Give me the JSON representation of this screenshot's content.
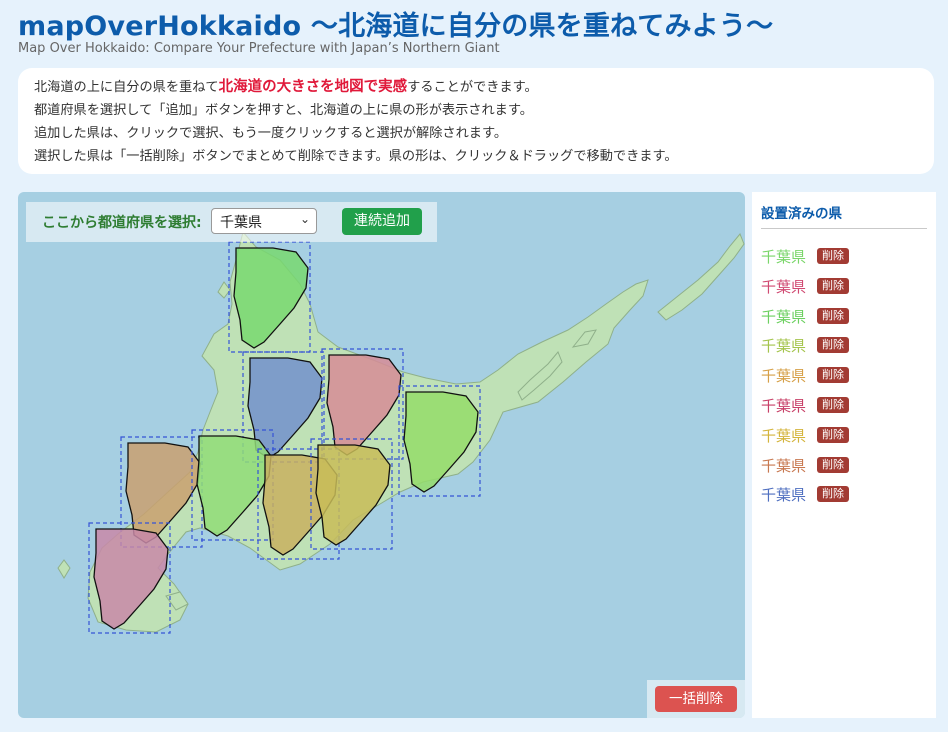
{
  "header": {
    "title": "mapOverHokkaido ～北海道に自分の県を重ねてみよう～",
    "subtitle": "Map Over Hokkaido: Compare Your Prefecture with Japan’s Northern Giant"
  },
  "description": {
    "line1_pre": "北海道の上に自分の県を重ねて",
    "line1_highlight": "北海道の大きさを地図で実感",
    "line1_post": "することができます。",
    "line2": "都道府県を選択して「追加」ボタンを押すと、北海道の上に県の形が表示されます。",
    "line3": "追加した県は、クリックで選択、もう一度クリックすると選択が解除されます。",
    "line4": "選択した県は「一括削除」ボタンでまとめて削除できます。県の形は、クリック＆ドラッグで移動できます。"
  },
  "controls": {
    "select_label": "ここから都道府県を選択:",
    "selected_prefecture": "千葉県",
    "add_button": "連続追加",
    "bulk_delete_button": "一括削除"
  },
  "sidebar": {
    "title": "設置済みの県",
    "delete_label": "削除",
    "items": [
      {
        "name": "千葉県",
        "color": "#7ad66a"
      },
      {
        "name": "千葉県",
        "color": "#d04a72"
      },
      {
        "name": "千葉県",
        "color": "#6cd060"
      },
      {
        "name": "千葉県",
        "color": "#a4c44c"
      },
      {
        "name": "千葉県",
        "color": "#d6a048"
      },
      {
        "name": "千葉県",
        "color": "#c84068"
      },
      {
        "name": "千葉県",
        "color": "#d4b43c"
      },
      {
        "name": "千葉県",
        "color": "#c87850"
      },
      {
        "name": "千葉県",
        "color": "#4f6fc0"
      }
    ]
  },
  "map": {
    "sea_color": "#a6cfe2",
    "land_color": "#bfe1b6",
    "overlay_colors": [
      "#78d870",
      "#7290cc",
      "#d68c96",
      "#94dc6a",
      "#c9a070",
      "#90dc78",
      "#c8b060",
      "#c8bc58",
      "#c888a8"
    ]
  }
}
